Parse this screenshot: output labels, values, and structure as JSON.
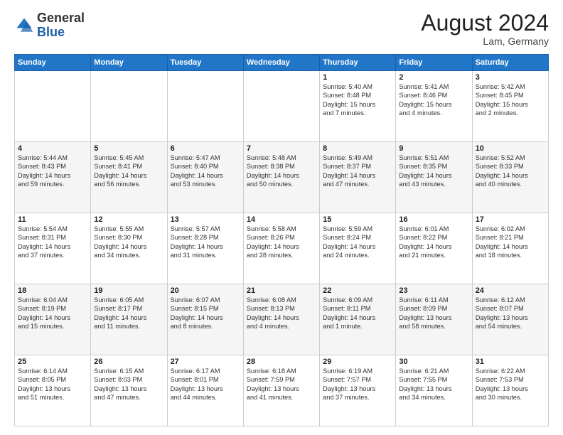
{
  "header": {
    "logo_general": "General",
    "logo_blue": "Blue",
    "month_year": "August 2024",
    "location": "Lam, Germany"
  },
  "weekdays": [
    "Sunday",
    "Monday",
    "Tuesday",
    "Wednesday",
    "Thursday",
    "Friday",
    "Saturday"
  ],
  "weeks": [
    [
      {
        "day": "",
        "info": ""
      },
      {
        "day": "",
        "info": ""
      },
      {
        "day": "",
        "info": ""
      },
      {
        "day": "",
        "info": ""
      },
      {
        "day": "1",
        "info": "Sunrise: 5:40 AM\nSunset: 8:48 PM\nDaylight: 15 hours\nand 7 minutes."
      },
      {
        "day": "2",
        "info": "Sunrise: 5:41 AM\nSunset: 8:46 PM\nDaylight: 15 hours\nand 4 minutes."
      },
      {
        "day": "3",
        "info": "Sunrise: 5:42 AM\nSunset: 8:45 PM\nDaylight: 15 hours\nand 2 minutes."
      }
    ],
    [
      {
        "day": "4",
        "info": "Sunrise: 5:44 AM\nSunset: 8:43 PM\nDaylight: 14 hours\nand 59 minutes."
      },
      {
        "day": "5",
        "info": "Sunrise: 5:45 AM\nSunset: 8:41 PM\nDaylight: 14 hours\nand 56 minutes."
      },
      {
        "day": "6",
        "info": "Sunrise: 5:47 AM\nSunset: 8:40 PM\nDaylight: 14 hours\nand 53 minutes."
      },
      {
        "day": "7",
        "info": "Sunrise: 5:48 AM\nSunset: 8:38 PM\nDaylight: 14 hours\nand 50 minutes."
      },
      {
        "day": "8",
        "info": "Sunrise: 5:49 AM\nSunset: 8:37 PM\nDaylight: 14 hours\nand 47 minutes."
      },
      {
        "day": "9",
        "info": "Sunrise: 5:51 AM\nSunset: 8:35 PM\nDaylight: 14 hours\nand 43 minutes."
      },
      {
        "day": "10",
        "info": "Sunrise: 5:52 AM\nSunset: 8:33 PM\nDaylight: 14 hours\nand 40 minutes."
      }
    ],
    [
      {
        "day": "11",
        "info": "Sunrise: 5:54 AM\nSunset: 8:31 PM\nDaylight: 14 hours\nand 37 minutes."
      },
      {
        "day": "12",
        "info": "Sunrise: 5:55 AM\nSunset: 8:30 PM\nDaylight: 14 hours\nand 34 minutes."
      },
      {
        "day": "13",
        "info": "Sunrise: 5:57 AM\nSunset: 8:28 PM\nDaylight: 14 hours\nand 31 minutes."
      },
      {
        "day": "14",
        "info": "Sunrise: 5:58 AM\nSunset: 8:26 PM\nDaylight: 14 hours\nand 28 minutes."
      },
      {
        "day": "15",
        "info": "Sunrise: 5:59 AM\nSunset: 8:24 PM\nDaylight: 14 hours\nand 24 minutes."
      },
      {
        "day": "16",
        "info": "Sunrise: 6:01 AM\nSunset: 8:22 PM\nDaylight: 14 hours\nand 21 minutes."
      },
      {
        "day": "17",
        "info": "Sunrise: 6:02 AM\nSunset: 8:21 PM\nDaylight: 14 hours\nand 18 minutes."
      }
    ],
    [
      {
        "day": "18",
        "info": "Sunrise: 6:04 AM\nSunset: 8:19 PM\nDaylight: 14 hours\nand 15 minutes."
      },
      {
        "day": "19",
        "info": "Sunrise: 6:05 AM\nSunset: 8:17 PM\nDaylight: 14 hours\nand 11 minutes."
      },
      {
        "day": "20",
        "info": "Sunrise: 6:07 AM\nSunset: 8:15 PM\nDaylight: 14 hours\nand 8 minutes."
      },
      {
        "day": "21",
        "info": "Sunrise: 6:08 AM\nSunset: 8:13 PM\nDaylight: 14 hours\nand 4 minutes."
      },
      {
        "day": "22",
        "info": "Sunrise: 6:09 AM\nSunset: 8:11 PM\nDaylight: 14 hours\nand 1 minute."
      },
      {
        "day": "23",
        "info": "Sunrise: 6:11 AM\nSunset: 8:09 PM\nDaylight: 13 hours\nand 58 minutes."
      },
      {
        "day": "24",
        "info": "Sunrise: 6:12 AM\nSunset: 8:07 PM\nDaylight: 13 hours\nand 54 minutes."
      }
    ],
    [
      {
        "day": "25",
        "info": "Sunrise: 6:14 AM\nSunset: 8:05 PM\nDaylight: 13 hours\nand 51 minutes."
      },
      {
        "day": "26",
        "info": "Sunrise: 6:15 AM\nSunset: 8:03 PM\nDaylight: 13 hours\nand 47 minutes."
      },
      {
        "day": "27",
        "info": "Sunrise: 6:17 AM\nSunset: 8:01 PM\nDaylight: 13 hours\nand 44 minutes."
      },
      {
        "day": "28",
        "info": "Sunrise: 6:18 AM\nSunset: 7:59 PM\nDaylight: 13 hours\nand 41 minutes."
      },
      {
        "day": "29",
        "info": "Sunrise: 6:19 AM\nSunset: 7:57 PM\nDaylight: 13 hours\nand 37 minutes."
      },
      {
        "day": "30",
        "info": "Sunrise: 6:21 AM\nSunset: 7:55 PM\nDaylight: 13 hours\nand 34 minutes."
      },
      {
        "day": "31",
        "info": "Sunrise: 6:22 AM\nSunset: 7:53 PM\nDaylight: 13 hours\nand 30 minutes."
      }
    ]
  ]
}
